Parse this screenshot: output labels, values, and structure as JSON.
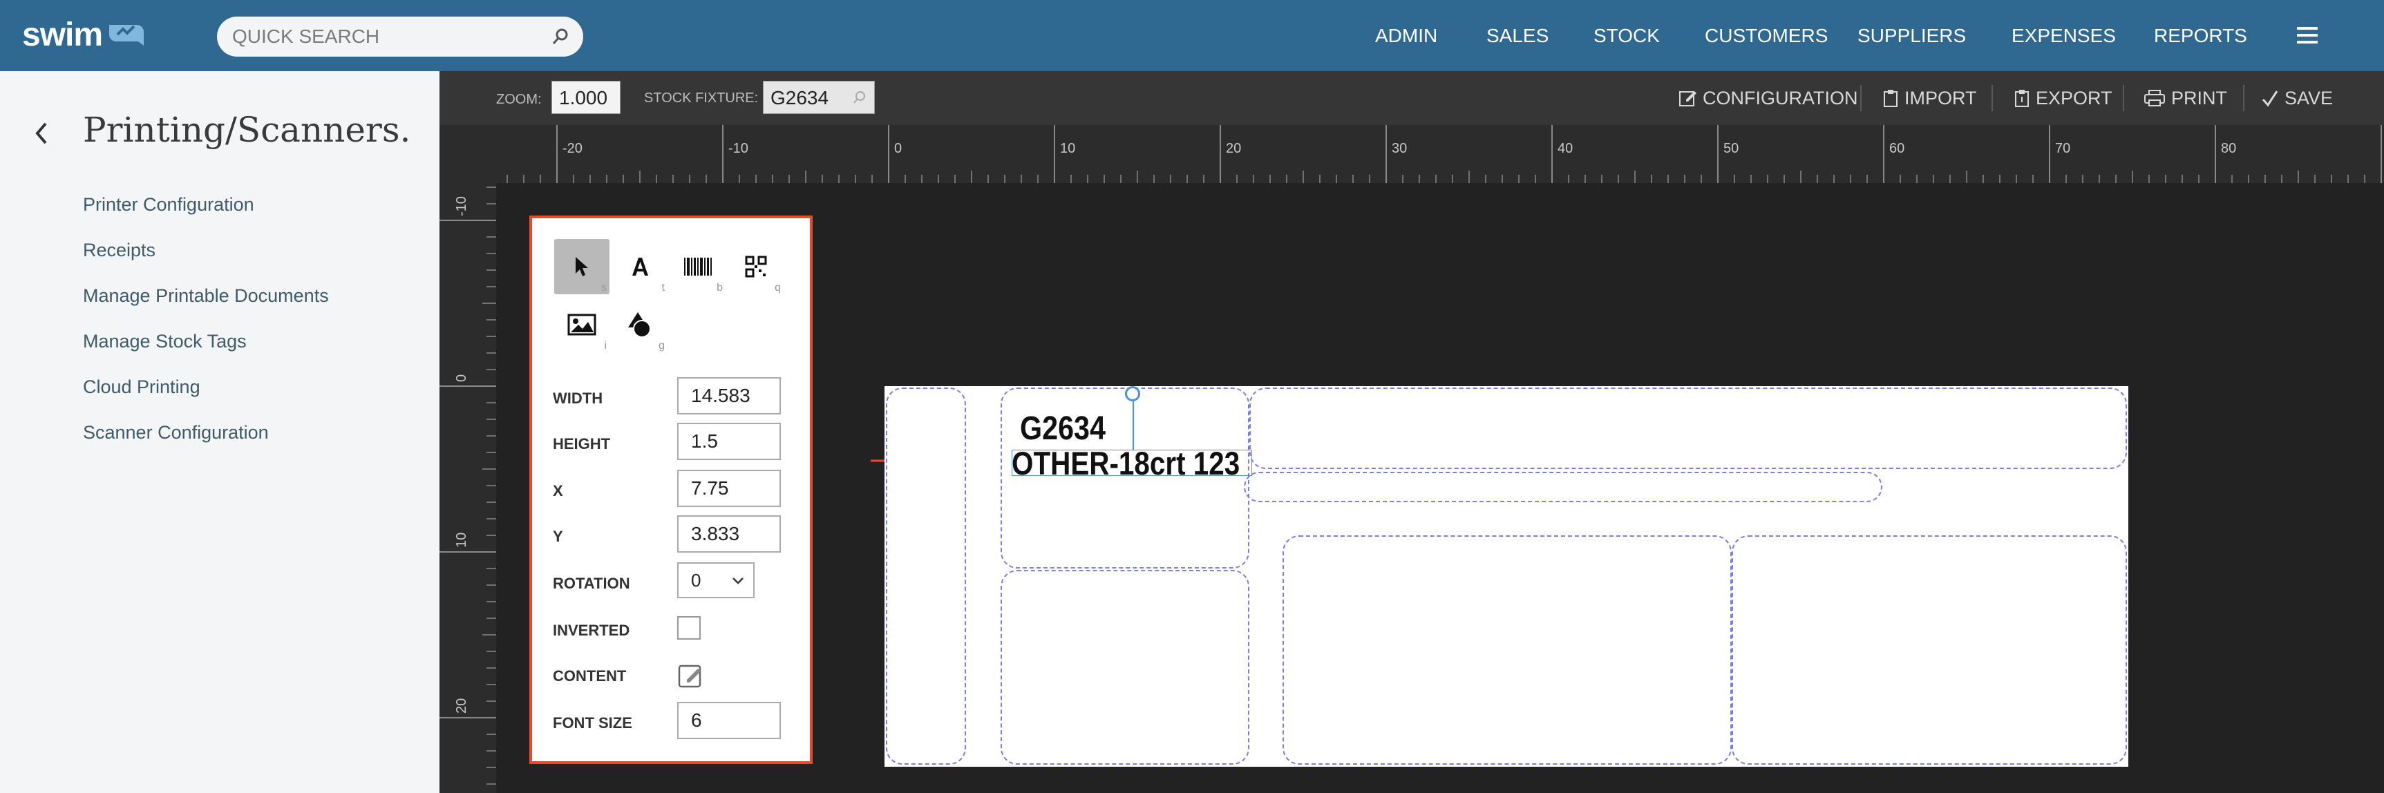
{
  "app": {
    "logo_text": "swim"
  },
  "search": {
    "placeholder": "QUICK SEARCH"
  },
  "nav": {
    "items": [
      "ADMIN",
      "SALES",
      "STOCK",
      "CUSTOMERS",
      "SUPPLIERS",
      "EXPENSES",
      "REPORTS"
    ]
  },
  "sidebar": {
    "title": "Printing/Scanners.",
    "items": [
      "Printer Configuration",
      "Receipts",
      "Manage Printable Documents",
      "Manage Stock Tags",
      "Cloud Printing",
      "Scanner Configuration"
    ]
  },
  "toolbar": {
    "zoom_label": "ZOOM:",
    "zoom_value": "1.000",
    "fixture_label": "STOCK FIXTURE:",
    "fixture_value": "G2634",
    "configuration": "CONFIGURATION",
    "import": "IMPORT",
    "export": "EXPORT",
    "print": "PRINT",
    "save": "SAVE"
  },
  "ruler": {
    "horizontal": [
      "-20",
      "-10",
      "0",
      "10",
      "20",
      "30",
      "40",
      "50",
      "60",
      "70",
      "80"
    ],
    "vertical": [
      "-10",
      "0",
      "10",
      "20"
    ]
  },
  "tools": {
    "keys": [
      "s",
      "t",
      "b",
      "q",
      "i",
      "g"
    ],
    "properties": {
      "width_label": "WIDTH",
      "width": "14.583",
      "height_label": "HEIGHT",
      "height": "1.5",
      "x_label": "X",
      "x": "7.75",
      "y_label": "Y",
      "y": "3.833",
      "rotation_label": "ROTATION",
      "rotation": "0",
      "inverted_label": "INVERTED",
      "inverted": false,
      "content_label": "CONTENT",
      "font_size_label": "FONT SIZE",
      "font_size": "6"
    }
  },
  "label": {
    "line1": "G2634",
    "line2": "OTHER-18crt 123"
  },
  "colors": {
    "header": "#2f6890",
    "accent_border": "#e84a2e",
    "region_outline": "#7b7ee6",
    "selection": "#4a90e2"
  }
}
